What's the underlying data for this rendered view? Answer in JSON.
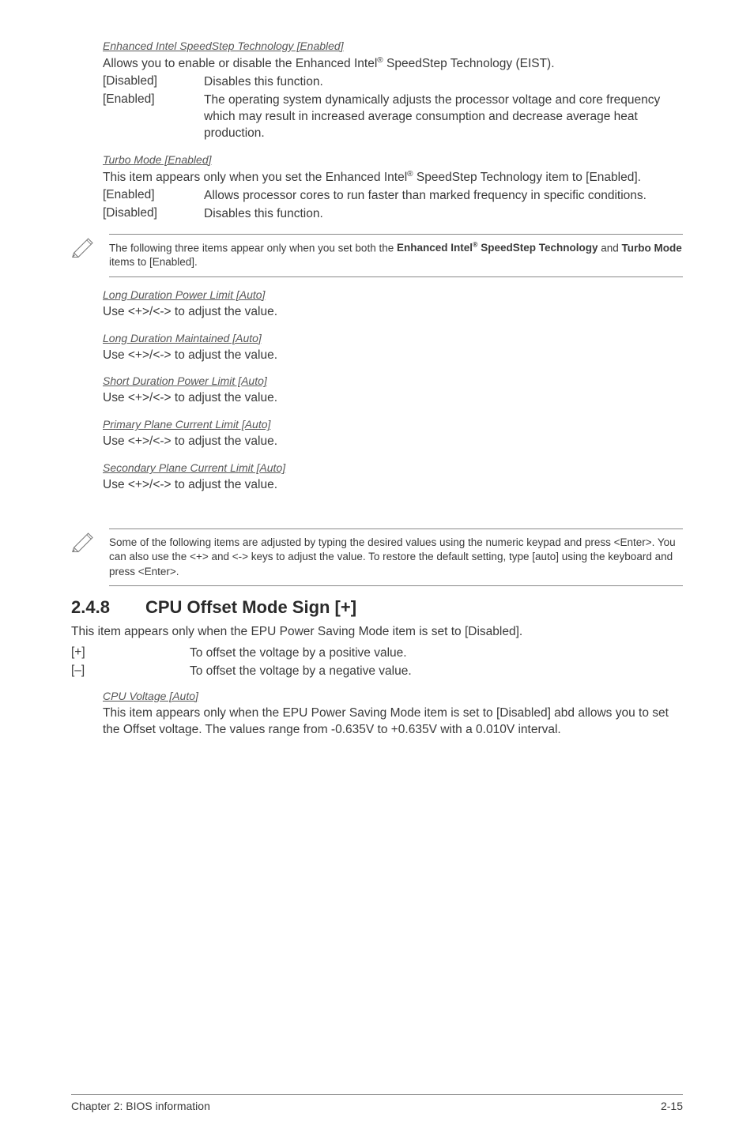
{
  "eist": {
    "title": "Enhanced Intel SpeedStep Technology [Enabled]",
    "desc_pre": "Allows you to enable or disable the Enhanced Intel",
    "desc_post": " SpeedStep Technology (EIST).",
    "opts": [
      {
        "label": "[Disabled]",
        "desc": "Disables this function."
      },
      {
        "label": "[Enabled]",
        "desc": "The operating system dynamically adjusts the processor voltage and core frequency which may result in increased average consumption and decrease average heat production."
      }
    ]
  },
  "turbo": {
    "title": "Turbo Mode [Enabled]",
    "desc_pre": "This item appears only when you set the Enhanced Intel",
    "desc_post": " SpeedStep Technology item to [Enabled].",
    "opts": [
      {
        "label": "[Enabled]",
        "desc": "Allows processor cores to run faster than marked frequency in specific conditions."
      },
      {
        "label": "[Disabled]",
        "desc": "Disables this function."
      }
    ]
  },
  "note1_pre": "The following three items appear only when you set both the ",
  "note1_b1": "Enhanced Intel",
  "note1_mid": " SpeedStep Technology",
  "note1_and": " and ",
  "note1_b2": "Turbo Mode",
  "note1_post": " items to [Enabled].",
  "adjitems": [
    {
      "title": "Long Duration Power Limit [Auto]",
      "desc": "Use <+>/<-> to adjust the value."
    },
    {
      "title": "Long Duration Maintained [Auto]",
      "desc": "Use <+>/<-> to adjust the value."
    },
    {
      "title": "Short Duration Power Limit [Auto]",
      "desc": "Use <+>/<-> to adjust the value."
    },
    {
      "title": "Primary Plane Current Limit [Auto]",
      "desc": "Use <+>/<-> to adjust the value."
    },
    {
      "title": "Secondary Plane Current Limit [Auto]",
      "desc": "Use <+>/<-> to adjust the value."
    }
  ],
  "note2": "Some of the following items are adjusted by typing the desired values using the numeric keypad and press <Enter>. You can also use the <+> and <-> keys to adjust the value. To restore the default setting, type [auto] using the keyboard and press <Enter>.",
  "section": {
    "num": "2.4.8",
    "title": "CPU Offset Mode Sign [+]"
  },
  "section_desc": "This item appears only when the EPU Power Saving Mode item is set to [Disabled].",
  "section_opts": [
    {
      "label": "[+]",
      "desc": "To offset the voltage by a positive value."
    },
    {
      "label": "[–]",
      "desc": "To offset the voltage by a negative value."
    }
  ],
  "cpuvolt": {
    "title": "CPU Voltage [Auto]",
    "desc": "This item appears only when the EPU Power Saving Mode item is set to [Disabled] abd allows you to set the Offset voltage. The values range from -0.635V to +0.635V with a 0.010V interval."
  },
  "footer": {
    "left": "Chapter 2: BIOS information",
    "right": "2-15"
  }
}
